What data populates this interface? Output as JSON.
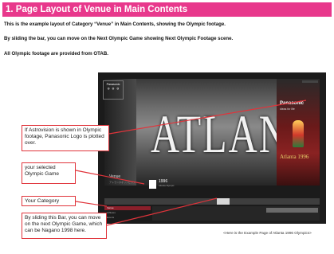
{
  "title": "1. Page Layout of Venue in Main Contents",
  "intro": [
    "This is the example layout of Category “Venue” in Main Contents, showing the Olympic footage.",
    "By sliding the bar, you can move on the Next Olympic Game showing Next Olympic Footage scene.",
    "All Olympic footage are provided  from OTAB."
  ],
  "screen": {
    "left_logo": "Panasonic",
    "photo_text": "ATLANTA",
    "right_logo": "Panasonic",
    "right_logo_sub": "ideas for life",
    "right_caption": "Atlanta 1996",
    "venue_label": "Venue",
    "venue_sub": "アトランタオリンピック",
    "game_year": "1996",
    "game_sub": "Atlanta Olympic",
    "categories": [
      "Venue",
      "Athletes",
      "Events"
    ]
  },
  "callouts": {
    "astrovision": "If Astrovision is shown in Olympic footage, Panasonic Logo is plotted over.",
    "selected_game": "your selected Olympic Game",
    "category": "Your Category",
    "slider": "By sliding this Bar, you can move on the next Olympic Game, which can be Nagano 1998 here."
  },
  "footnote": "<Here is the Example Page of Atlanta 1996 Olympics>",
  "colors": {
    "accent": "#e8388c",
    "callout_border": "#e0343b",
    "arrow": "#e0343b"
  },
  "icons": {
    "olympic_rings": "olympic-rings-icon"
  }
}
